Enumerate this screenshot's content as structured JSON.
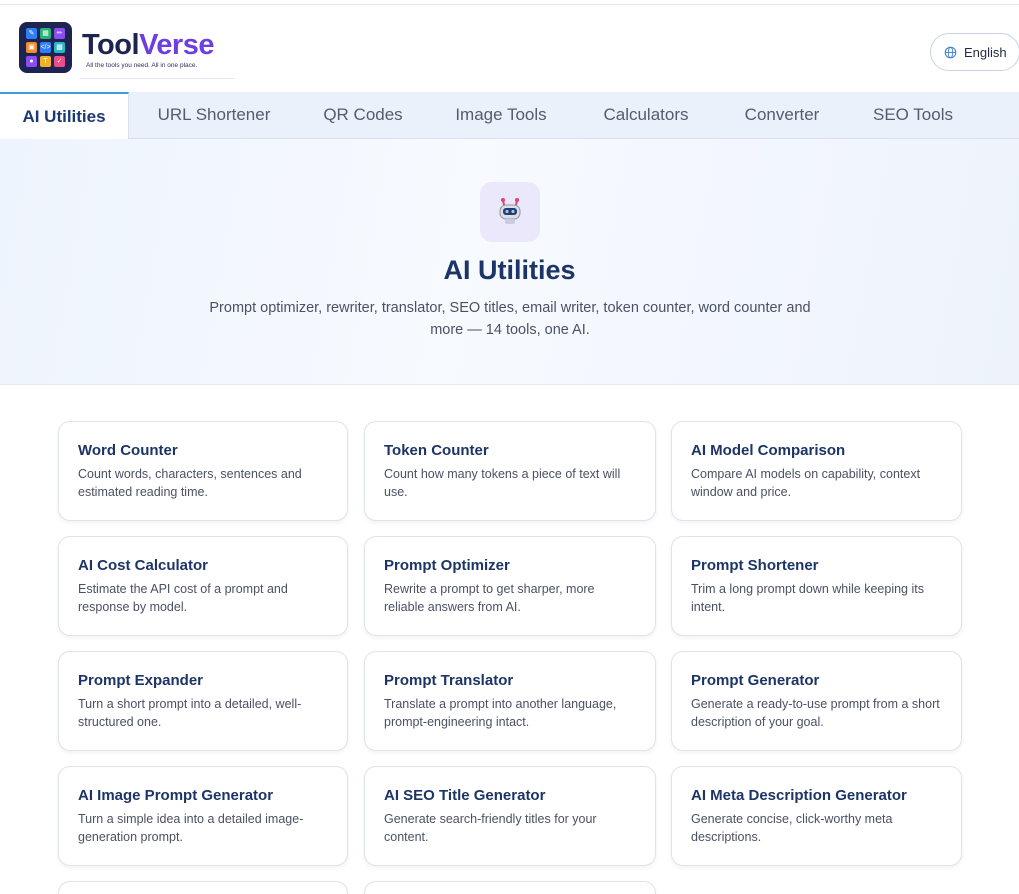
{
  "brand": {
    "name_part1": "Tool",
    "name_part2": "Verse",
    "tagline": "All the tools you need. All in one place."
  },
  "language": {
    "label": "English",
    "icon": "globe-icon"
  },
  "tabs": [
    {
      "label": "AI Utilities",
      "active": true
    },
    {
      "label": "URL Shortener"
    },
    {
      "label": "QR Codes"
    },
    {
      "label": "Image Tools"
    },
    {
      "label": "Calculators"
    },
    {
      "label": "Converter"
    },
    {
      "label": "SEO Tools"
    }
  ],
  "hero": {
    "icon": "robot-icon",
    "title": "AI Utilities",
    "description": "Prompt optimizer, rewriter, translator, SEO titles, email writer, token counter, word counter and more — 14 tools, one AI."
  },
  "tools": [
    {
      "title": "Word Counter",
      "desc": "Count words, characters, sentences and estimated reading time."
    },
    {
      "title": "Token Counter",
      "desc": "Count how many tokens a piece of text will use."
    },
    {
      "title": "AI Model Comparison",
      "desc": "Compare AI models on capability, context window and price."
    },
    {
      "title": "AI Cost Calculator",
      "desc": "Estimate the API cost of a prompt and response by model."
    },
    {
      "title": "Prompt Optimizer",
      "desc": "Rewrite a prompt to get sharper, more reliable answers from AI."
    },
    {
      "title": "Prompt Shortener",
      "desc": "Trim a long prompt down while keeping its intent."
    },
    {
      "title": "Prompt Expander",
      "desc": "Turn a short prompt into a detailed, well-structured one."
    },
    {
      "title": "Prompt Translator",
      "desc": "Translate a prompt into another language, prompt-engineering intact."
    },
    {
      "title": "Prompt Generator",
      "desc": "Generate a ready-to-use prompt from a short description of your goal."
    },
    {
      "title": "AI Image Prompt Generator",
      "desc": "Turn a simple idea into a detailed image-generation prompt."
    },
    {
      "title": "AI SEO Title Generator",
      "desc": "Generate search-friendly titles for your content."
    },
    {
      "title": "AI Meta Description Generator",
      "desc": "Generate concise, click-worthy meta descriptions."
    }
  ],
  "colors": {
    "brand_dark": "#1c2450",
    "brand_accent": "#6c3fe0",
    "heading": "#1c3566",
    "tab_active_border": "#3aa0d8"
  }
}
